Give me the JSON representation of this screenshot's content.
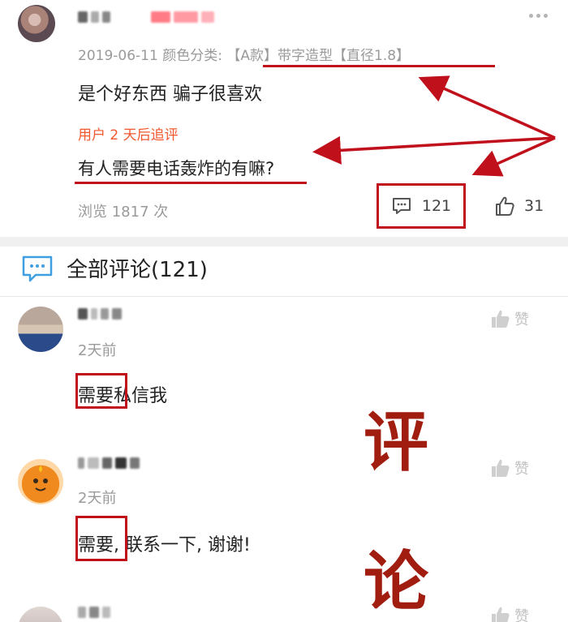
{
  "review": {
    "date": "2019-06-11",
    "category_label": "颜色分类:",
    "category_value": "【A款】带字造型【直径1.8】",
    "content": "是个好东西 骗子很喜欢",
    "followup_label": "用户 2 天后追评",
    "followup_text": "有人需要电话轰炸的有嘛?",
    "views": "浏览 1817 次",
    "comment_count": "121",
    "like_count": "31"
  },
  "all_comments": {
    "title": "全部评论(121)"
  },
  "comments": [
    {
      "time": "2天前",
      "highlight": "需要",
      "rest": "私信我",
      "like_label": "赞"
    },
    {
      "time": "2天前",
      "highlight": "需要",
      "rest": ", 联系一下, 谢谢!",
      "like_label": "赞"
    },
    {
      "like_label": "赞"
    }
  ],
  "annotation": {
    "char_1": "评",
    "char_2": "论"
  },
  "colors": {
    "annotation_red": "#c0101b",
    "followup_orange": "#f2572d",
    "meta_gray": "#9a9a9a",
    "annotation_text": "#a01d10"
  }
}
